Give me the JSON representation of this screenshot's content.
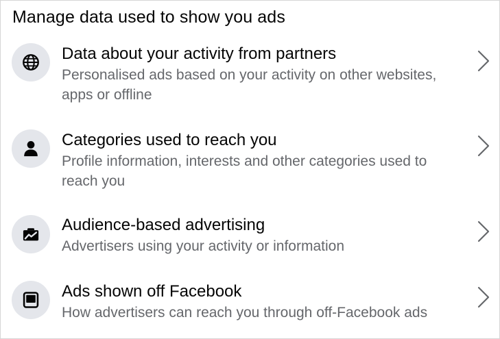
{
  "section": {
    "title": "Manage data used to show you ads"
  },
  "items": [
    {
      "icon": "globe-icon",
      "title": "Data about your activity from partners",
      "description": "Personalised ads based on your activity on other websites, apps or offline"
    },
    {
      "icon": "person-icon",
      "title": "Categories used to reach you",
      "description": "Profile information, interests and other categories used to reach you"
    },
    {
      "icon": "briefcase-chart-icon",
      "title": "Audience-based advertising",
      "description": "Advertisers using your activity or information"
    },
    {
      "icon": "device-icon",
      "title": "Ads shown off Facebook",
      "description": "How advertisers can reach you through off-Facebook ads"
    }
  ],
  "colors": {
    "icon_background": "#e4e6eb",
    "primary_text": "#050505",
    "secondary_text": "#65676b",
    "chevron": "#65676b"
  }
}
